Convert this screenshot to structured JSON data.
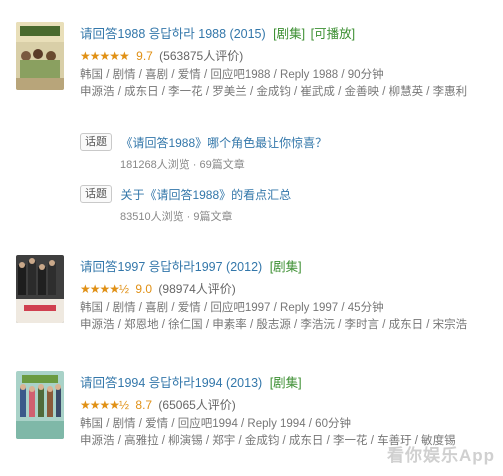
{
  "items": [
    {
      "title": "请回答1988 응답하라 1988 (2015)",
      "tags": [
        "[剧集]",
        "[可播放]"
      ],
      "stars": "★★★★★",
      "score": "9.7",
      "votes": "(563875人评价)",
      "meta": "韩国 / 剧情 / 喜剧 / 爱情 / 回应吧1988 / Reply 1988 / 90分钟",
      "cast": "申源浩 / 成东日 / 李一花 / 罗美兰 / 金成钧 / 崔武成 / 金善映 / 柳慧英 / 李惠利",
      "topics": [
        {
          "badge": "话题",
          "link": "《请回答1988》哪个角色最让你惊喜？",
          "stats": "181268人浏览 · 69篇文章"
        },
        {
          "badge": "话题",
          "link": "关于《请回答1988》的看点汇总",
          "stats": "83510人浏览 · 9篇文章"
        }
      ]
    },
    {
      "title": "请回答1997 응답하라1997 (2012)",
      "tags": [
        "[剧集]"
      ],
      "stars": "★★★★½",
      "score": "9.0",
      "votes": "(98974人评价)",
      "meta": "韩国 / 剧情 / 喜剧 / 爱情 / 回应吧1997 / Reply 1997 / 45分钟",
      "cast": "申源浩 / 郑恩地 / 徐仁国 / 申素率 / 殷志源 / 李浩沅 / 李时言 / 成东日 / 宋宗浩"
    },
    {
      "title": "请回答1994 응답하라1994 (2013)",
      "tags": [
        "[剧集]"
      ],
      "stars": "★★★★½",
      "score": "8.7",
      "votes": "(65065人评价)",
      "meta": "韩国 / 剧情 / 爱情 / 回应吧1994 / Reply 1994 / 60分钟",
      "cast": "申源浩 / 高雅拉 / 柳演锡 / 郑宇 / 金成钧 / 成东日 / 李一花 / 车善玗 / 敏度锡"
    }
  ],
  "watermark": "看你娱乐App"
}
